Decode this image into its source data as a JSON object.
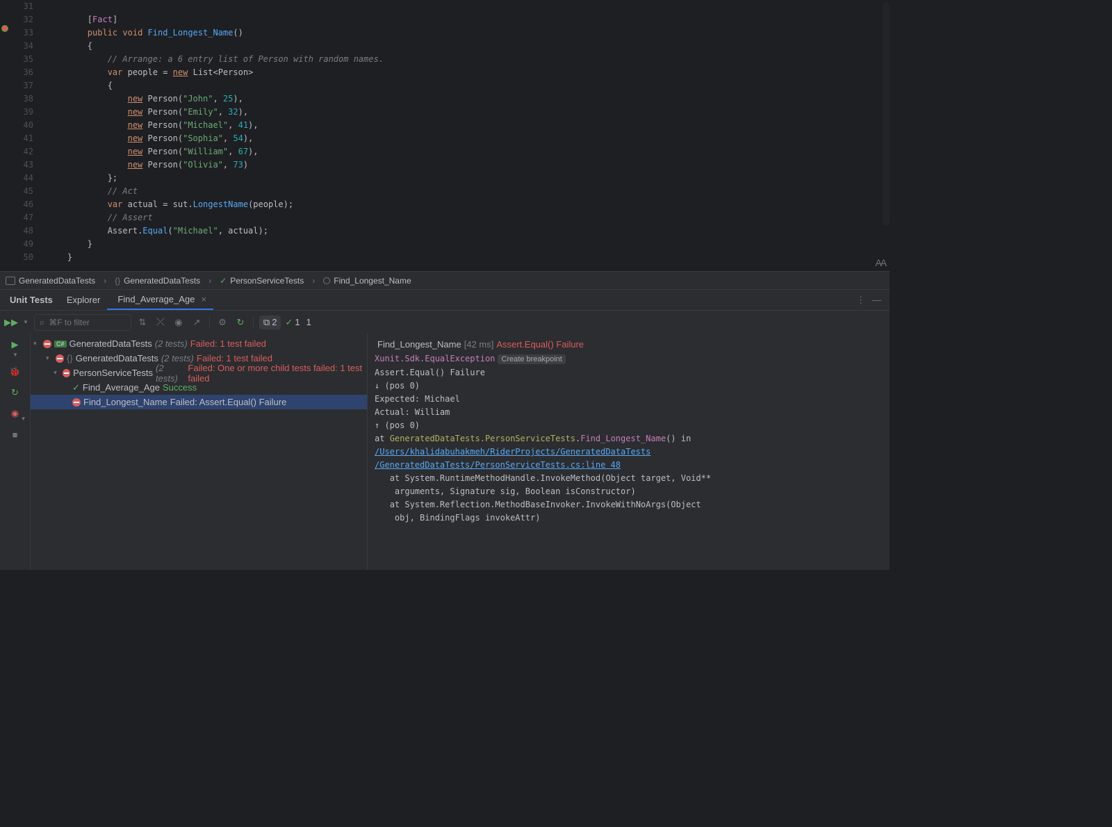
{
  "gutter": {
    "start": 31,
    "end": 50
  },
  "codeLines": [
    "",
    "        <span class='c-brace'>[</span><span class='c-attr'>Fact</span><span class='c-brace'>]</span>",
    "        <span class='c-kw'>public</span> <span class='c-kw'>void</span> <span class='c-fn'>Find_Longest_Name</span><span class='c-brace'>()</span>",
    "        <span class='c-brace'>{</span>",
    "            <span class='c-cmt'>// Arrange: a 6 entry list of Person with random names.</span>",
    "            <span class='c-kw'>var</span> <span class='c-var'>people</span> = <span class='c-new'>new</span> <span class='c-type'>List&lt;Person&gt;</span>",
    "            <span class='c-brace'>{</span>",
    "                <span class='c-new'>new</span> <span class='c-type'>Person</span>(<span class='c-str'>\"John\"</span>, <span class='c-num'>25</span>),",
    "                <span class='c-new'>new</span> <span class='c-type'>Person</span>(<span class='c-str'>\"Emily\"</span>, <span class='c-num'>32</span>),",
    "                <span class='c-new'>new</span> <span class='c-type'>Person</span>(<span class='c-str'>\"Michael\"</span>, <span class='c-num'>41</span>),",
    "                <span class='c-new'>new</span> <span class='c-type'>Person</span>(<span class='c-str'>\"Sophia\"</span>, <span class='c-num'>54</span>),",
    "                <span class='c-new'>new</span> <span class='c-type'>Person</span>(<span class='c-str'>\"William\"</span>, <span class='c-num'>67</span>),",
    "                <span class='c-new'>new</span> <span class='c-type'>Person</span>(<span class='c-str'>\"Olivia\"</span>, <span class='c-num'>73</span>)",
    "            <span class='c-brace'>};</span>",
    "            <span class='c-cmt'>// Act</span>",
    "            <span class='c-kw'>var</span> <span class='c-var'>actual</span> = <span class='c-var'>sut</span>.<span class='c-fn'>LongestName</span>(people);",
    "            <span class='c-cmt'>// Assert</span>",
    "            <span class='c-type'>Assert</span>.<span class='c-fn'>Equal</span>(<span class='c-str'>\"Michael\"</span>, actual);",
    "        <span class='c-brace'>}</span>",
    "    <span class='c-brace'>}</span>"
  ],
  "breadcrumb": {
    "items": [
      {
        "label": "GeneratedDataTests",
        "icon": "project"
      },
      {
        "label": "GeneratedDataTests",
        "icon": "namespace"
      },
      {
        "label": "PersonServiceTests",
        "icon": "class-pass"
      },
      {
        "label": "Find_Longest_Name",
        "icon": "method"
      }
    ]
  },
  "panelTabs": {
    "unitTests": "Unit Tests",
    "explorer": "Explorer",
    "active": "Find_Average_Age"
  },
  "toolbar": {
    "searchPlaceholder": "⌘F to filter",
    "broken": "2",
    "passed": "1",
    "failed": "1"
  },
  "tree": {
    "root": {
      "name": "GeneratedDataTests",
      "count": "(2 tests)",
      "status": "Failed: 1 test failed"
    },
    "ns": {
      "name": "GeneratedDataTests",
      "count": "(2 tests)",
      "status": "Failed: 1 test failed"
    },
    "cls": {
      "name": "PersonServiceTests",
      "count": "(2 tests)",
      "status": "Failed: One or more child tests failed: 1 test failed"
    },
    "t1": {
      "name": "Find_Average_Age",
      "status": "Success"
    },
    "t2": {
      "name": "Find_Longest_Name",
      "status": "Failed: Assert.Equal() Failure"
    }
  },
  "output": {
    "headerName": "Find_Longest_Name",
    "headerTime": "[42 ms]",
    "headerMsg": "Assert.Equal() Failure",
    "exc": "Xunit.Sdk.EqualException",
    "cb": "Create breakpoint",
    "l1": "Assert.Equal() Failure",
    "l2": "          ↓ (pos 0)",
    "l3": "Expected: Michael",
    "l4": "Actual:   William",
    "l5": "          ↑ (pos 0)",
    "at1a": "   at ",
    "at1b": "GeneratedDataTests.PersonServiceTests",
    "at1c": ".",
    "at1d": "Find_Longest_Name",
    "at1e": "() in ",
    "link1": "/Users/khalidabuhakmeh/RiderProjects/GeneratedDataTests",
    "link2": "/GeneratedDataTests/PersonServiceTests.cs:line 48",
    "at2": "   at System.RuntimeMethodHandle.InvokeMethod(Object target, Void**\n    arguments, Signature sig, Boolean isConstructor)",
    "at3": "   at System.Reflection.MethodBaseInvoker.InvokeWithNoArgs(Object\n    obj, BindingFlags invokeAttr)"
  }
}
